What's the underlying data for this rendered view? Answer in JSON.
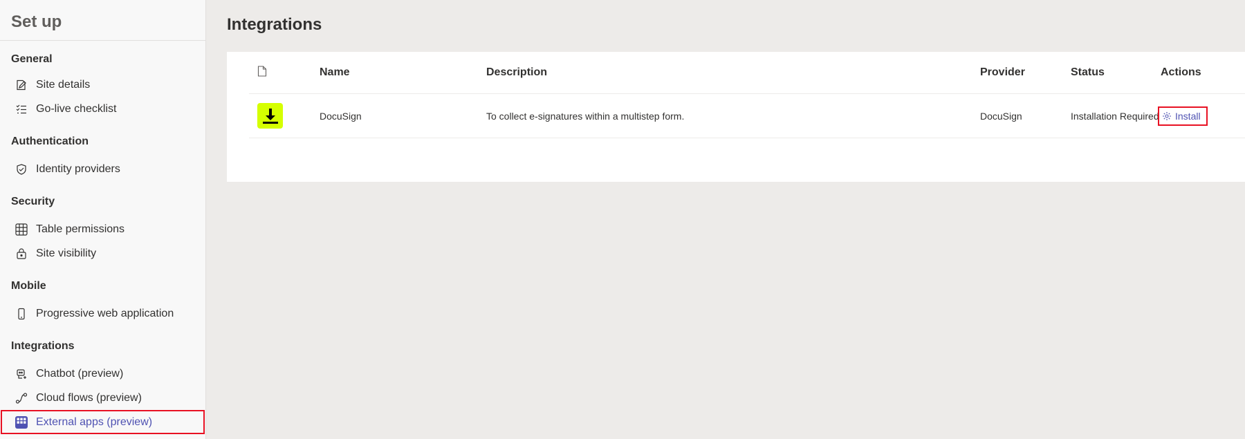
{
  "sidebar": {
    "title": "Set up",
    "sections": [
      {
        "header": "General",
        "items": [
          {
            "label": "Site details",
            "icon": "edit-form-icon"
          },
          {
            "label": "Go-live checklist",
            "icon": "checklist-icon"
          }
        ]
      },
      {
        "header": "Authentication",
        "items": [
          {
            "label": "Identity providers",
            "icon": "shield-icon"
          }
        ]
      },
      {
        "header": "Security",
        "items": [
          {
            "label": "Table permissions",
            "icon": "table-icon"
          },
          {
            "label": "Site visibility",
            "icon": "lock-icon"
          }
        ]
      },
      {
        "header": "Mobile",
        "items": [
          {
            "label": "Progressive web application",
            "icon": "phone-icon"
          }
        ]
      },
      {
        "header": "Integrations",
        "items": [
          {
            "label": "Chatbot (preview)",
            "icon": "bot-icon"
          },
          {
            "label": "Cloud flows (preview)",
            "icon": "flow-icon"
          },
          {
            "label": "External apps (preview)",
            "icon": "apps-grid-icon",
            "active": true
          }
        ]
      }
    ]
  },
  "main": {
    "title": "Integrations",
    "table": {
      "columns": [
        "Name",
        "Description",
        "Provider",
        "Status",
        "Actions"
      ],
      "rows": [
        {
          "name": "DocuSign",
          "description": "To collect e-signatures within a multistep form.",
          "provider": "DocuSign",
          "status": "Installation Required",
          "action": "Install"
        }
      ]
    }
  },
  "colors": {
    "accent": "#4f52b2",
    "highlight_border": "#e81123",
    "logo_bg": "#d5ff00"
  }
}
